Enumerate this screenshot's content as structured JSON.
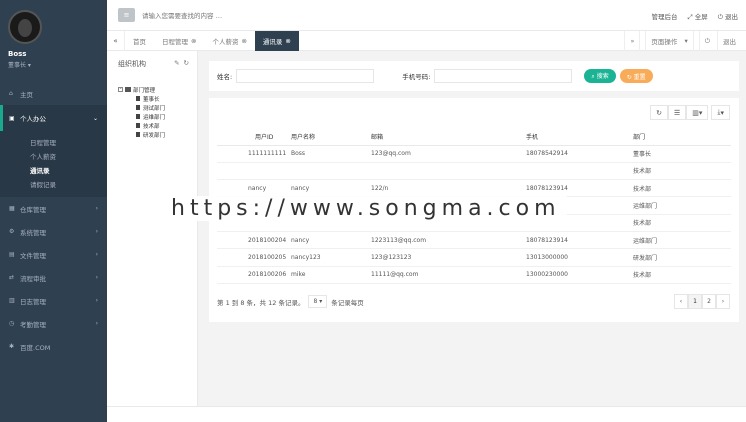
{
  "colors": {
    "sidebar": "#2f4050",
    "accent": "#1ab394",
    "warning": "#f8ac59"
  },
  "user": {
    "name": "Boss",
    "role": "董事长"
  },
  "nav": [
    {
      "icon": "home-icon",
      "label": "主页"
    },
    {
      "icon": "briefcase-icon",
      "label": "个人办公"
    },
    {
      "icon": "cube-icon",
      "label": "仓库管理"
    },
    {
      "icon": "gear-icon",
      "label": "系统管理"
    },
    {
      "icon": "file-icon",
      "label": "文件管理"
    },
    {
      "icon": "shuffle-icon",
      "label": "流程审批"
    },
    {
      "icon": "calendar-icon",
      "label": "日志管理"
    },
    {
      "icon": "clock-icon",
      "label": "考勤管理"
    },
    {
      "icon": "globe-icon",
      "label": "百度.COM"
    }
  ],
  "subnav": [
    "日程管理",
    "个人薪资",
    "通讯录",
    "请假记录"
  ],
  "topbar": {
    "search_placeholder": "请输入您需要查找的内容 …",
    "items": [
      "管理后台",
      "全屏",
      "退出"
    ]
  },
  "tabs": [
    "首页",
    "日程管理",
    "个人薪资",
    "通讯录"
  ],
  "tab_right": [
    "页面操作",
    "退出"
  ],
  "org": {
    "title": "组织机构",
    "root": "部门管理",
    "depts": [
      "董事长",
      "测试部门",
      "运维部门",
      "技术部",
      "研发部门"
    ]
  },
  "search": {
    "name_label": "姓名:",
    "phone_label": "手机号码:",
    "search_btn": "搜索",
    "reset_btn": "重置"
  },
  "table": {
    "headers": [
      "用户ID",
      "用户名称",
      "邮箱",
      "手机",
      "部门"
    ],
    "rows": [
      [
        "1111111111",
        "Boss",
        "123@qq.com",
        "18078542914",
        "董事长"
      ],
      [
        "",
        "",
        "",
        "",
        "技术部"
      ],
      [
        "nancy",
        "nancy",
        "122/n",
        "18078123914",
        "技术部"
      ],
      [
        "",
        "",
        "",
        "",
        "运维部门"
      ],
      [
        "",
        "",
        "",
        "",
        "技术部"
      ],
      [
        "2018100204",
        "nancy",
        "1223113@qq.com",
        "18078123914",
        "运维部门"
      ],
      [
        "2018100205",
        "nancy123",
        "123@123123",
        "13013000000",
        "研发部门"
      ],
      [
        "2018100206",
        "mike",
        "11111@qq.com",
        "13000230000",
        "技术部"
      ]
    ]
  },
  "pager": {
    "summary": "第 1 到 8 条，共 12 条记录。",
    "page_size": "8",
    "per_page": "条记录每页",
    "pages": [
      "‹",
      "1",
      "2",
      "›"
    ]
  },
  "watermark": "https://www.songma.com"
}
